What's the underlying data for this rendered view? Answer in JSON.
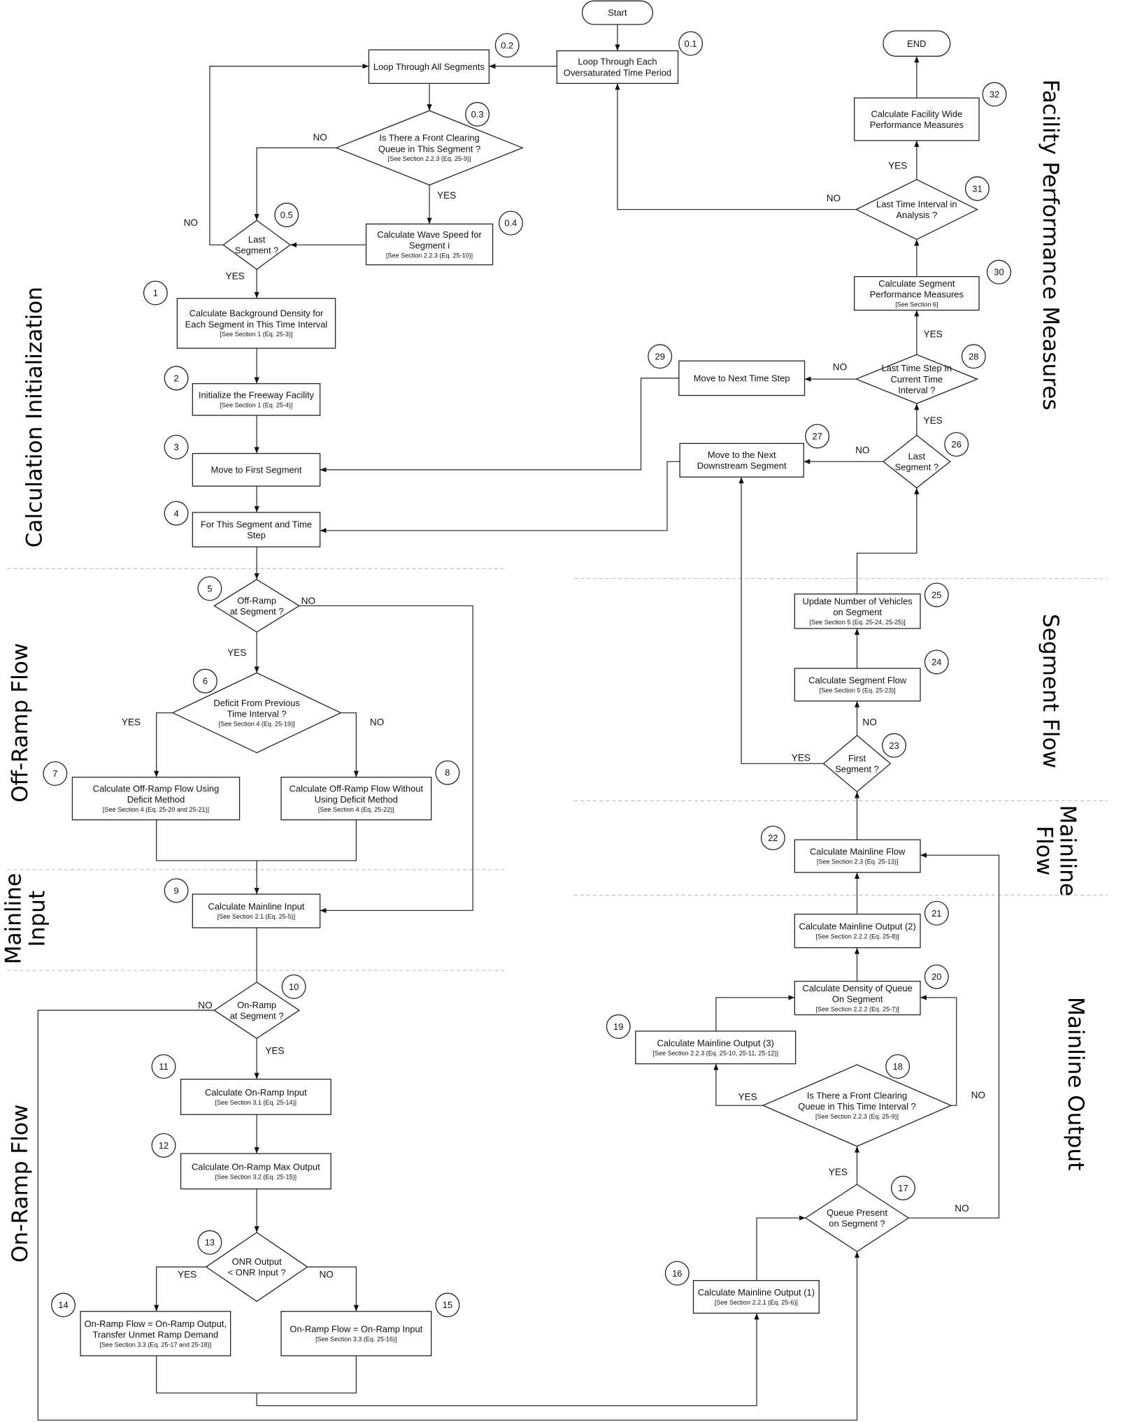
{
  "nodes": [
    {
      "id": "start",
      "step": "",
      "lines": [
        "Start"
      ],
      "ref": ""
    },
    {
      "id": "end",
      "step": "",
      "lines": [
        "END"
      ],
      "ref": ""
    },
    {
      "id": "0.1",
      "step": "0.1",
      "lines": [
        "Loop Through Each",
        "Oversaturated Time Period"
      ],
      "ref": ""
    },
    {
      "id": "0.2",
      "step": "0.2",
      "lines": [
        "Loop Through All Segments"
      ],
      "ref": ""
    },
    {
      "id": "0.3",
      "step": "0.3",
      "lines": [
        "Is There a Front Clearing",
        "Queue in This Segment ?"
      ],
      "ref": "[See Section 2.2.3 (Eq. 25-9)]"
    },
    {
      "id": "0.4",
      "step": "0.4",
      "lines": [
        "Calculate Wave Speed for",
        "Segment i"
      ],
      "ref": "[See Section 2.2.3 (Eq. 25-10)]"
    },
    {
      "id": "0.5",
      "step": "0.5",
      "lines": [
        "Last",
        "Segment ?"
      ],
      "ref": ""
    },
    {
      "id": "1",
      "step": "1",
      "lines": [
        "Calculate Background Density for",
        "Each Segment in This Time Interval"
      ],
      "ref": "[See Section 1 (Eq. 25-3)]"
    },
    {
      "id": "2",
      "step": "2",
      "lines": [
        "Initialize the Freeway Facility"
      ],
      "ref": "[See Section 1 (Eq. 25-4)]"
    },
    {
      "id": "3",
      "step": "3",
      "lines": [
        "Move to First Segment"
      ],
      "ref": ""
    },
    {
      "id": "4",
      "step": "4",
      "lines": [
        "For This Segment and Time",
        "Step"
      ],
      "ref": ""
    },
    {
      "id": "5",
      "step": "5",
      "lines": [
        "Off-Ramp",
        "at Segment ?"
      ],
      "ref": ""
    },
    {
      "id": "6",
      "step": "6",
      "lines": [
        "Deficit From Previous",
        "Time Interval ?"
      ],
      "ref": "[See Section 4 (Eq. 25-19)]"
    },
    {
      "id": "7",
      "step": "7",
      "lines": [
        "Calculate Off-Ramp Flow Using",
        "Deficit Method"
      ],
      "ref": "[See Section 4 (Eq. 25-20 and 25-21)]"
    },
    {
      "id": "8",
      "step": "8",
      "lines": [
        "Calculate Off-Ramp Flow Without",
        "Using Deficit Method"
      ],
      "ref": "[See Section 4 (Eq. 25-22)]"
    },
    {
      "id": "9",
      "step": "9",
      "lines": [
        "Calculate Mainline Input"
      ],
      "ref": "[See Section 2.1 (Eq. 25-5)]"
    },
    {
      "id": "10",
      "step": "10",
      "lines": [
        "On-Ramp",
        "at Segment ?"
      ],
      "ref": ""
    },
    {
      "id": "11",
      "step": "11",
      "lines": [
        "Calculate On-Ramp Input"
      ],
      "ref": "[See Section 3.1 (Eq. 25-14)]"
    },
    {
      "id": "12",
      "step": "12",
      "lines": [
        "Calculate On-Ramp Max Output"
      ],
      "ref": "[See Section 3.2 (Eq. 25-15)]"
    },
    {
      "id": "13",
      "step": "13",
      "lines": [
        "ONR Output",
        "< ONR Input ?"
      ],
      "ref": ""
    },
    {
      "id": "14",
      "step": "14",
      "lines": [
        "On-Ramp Flow = On-Ramp Output,",
        "Transfer Unmet Ramp Demand"
      ],
      "ref": "[See Section 3.3 (Eq. 25-17 and 25-18)]"
    },
    {
      "id": "15",
      "step": "15",
      "lines": [
        "On-Ramp Flow = On-Ramp Input"
      ],
      "ref": "[See Section 3.3 (Eq. 25-16)]"
    },
    {
      "id": "16",
      "step": "16",
      "lines": [
        "Calculate Mainline Output (1)"
      ],
      "ref": "[See Section 2.2.1 (Eq. 25-6)]"
    },
    {
      "id": "17",
      "step": "17",
      "lines": [
        "Queue Present",
        "on Segment ?"
      ],
      "ref": ""
    },
    {
      "id": "18",
      "step": "18",
      "lines": [
        "Is There a Front Clearing",
        "Queue in This Time Interval ?"
      ],
      "ref": "[See Section 2.2.3 (Eq. 25-9)]"
    },
    {
      "id": "19",
      "step": "19",
      "lines": [
        "Calculate Mainline Output (3)"
      ],
      "ref": "[See Section 2.2.3 (Eq. 25-10, 25-11, 25-12)]"
    },
    {
      "id": "20",
      "step": "20",
      "lines": [
        "Calculate Density of Queue",
        "On Segment"
      ],
      "ref": "[See Section 2.2.2 (Eq. 25-7)]"
    },
    {
      "id": "21",
      "step": "21",
      "lines": [
        "Calculate Mainline Output (2)"
      ],
      "ref": "[See Section 2.2.2 (Eq. 25-8)]"
    },
    {
      "id": "22",
      "step": "22",
      "lines": [
        "Calculate Mainline Flow"
      ],
      "ref": "[See Section 2.3 (Eq. 25-13)]"
    },
    {
      "id": "23",
      "step": "23",
      "lines": [
        "First",
        "Segment ?"
      ],
      "ref": ""
    },
    {
      "id": "24",
      "step": "24",
      "lines": [
        "Calculate Segment Flow"
      ],
      "ref": "[See Section 5 (Eq. 25-23)]"
    },
    {
      "id": "25",
      "step": "25",
      "lines": [
        "Update Number of Vehicles",
        "on Segment"
      ],
      "ref": "[See Section 5 (Eq. 25-24, 25-25)]"
    },
    {
      "id": "26",
      "step": "26",
      "lines": [
        "Last",
        "Segment ?"
      ],
      "ref": ""
    },
    {
      "id": "27",
      "step": "27",
      "lines": [
        "Move to the Next",
        "Downstream Segment"
      ],
      "ref": ""
    },
    {
      "id": "28",
      "step": "28",
      "lines": [
        "Last Time Step In",
        "Current Time",
        "Interval ?"
      ],
      "ref": ""
    },
    {
      "id": "29",
      "step": "29",
      "lines": [
        "Move to Next Time Step"
      ],
      "ref": ""
    },
    {
      "id": "30",
      "step": "30",
      "lines": [
        "Calculate Segment",
        "Performance Measures"
      ],
      "ref": "[See Section 6]"
    },
    {
      "id": "31",
      "step": "31",
      "lines": [
        "Last Time Interval in",
        "Analysis ?"
      ],
      "ref": ""
    },
    {
      "id": "32",
      "step": "32",
      "lines": [
        "Calculate Facility Wide",
        "Performance Measures"
      ],
      "ref": ""
    }
  ],
  "edges": [
    {
      "from": "start",
      "to": "0.1",
      "label": ""
    },
    {
      "from": "0.1",
      "to": "0.2",
      "label": ""
    },
    {
      "from": "0.2",
      "to": "0.3",
      "label": ""
    },
    {
      "from": "0.3",
      "to": "0.5",
      "label": "NO"
    },
    {
      "from": "0.3",
      "to": "0.4",
      "label": "YES"
    },
    {
      "from": "0.4",
      "to": "0.5",
      "label": ""
    },
    {
      "from": "0.5",
      "to": "0.2",
      "label": "NO"
    },
    {
      "from": "0.5",
      "to": "1",
      "label": "YES"
    },
    {
      "from": "1",
      "to": "2",
      "label": ""
    },
    {
      "from": "2",
      "to": "3",
      "label": ""
    },
    {
      "from": "3",
      "to": "4",
      "label": ""
    },
    {
      "from": "4",
      "to": "5",
      "label": ""
    },
    {
      "from": "5",
      "to": "9",
      "label": "NO"
    },
    {
      "from": "5",
      "to": "6",
      "label": "YES"
    },
    {
      "from": "6",
      "to": "7",
      "label": "YES"
    },
    {
      "from": "6",
      "to": "8",
      "label": "NO"
    },
    {
      "from": "7",
      "to": "9",
      "label": ""
    },
    {
      "from": "8",
      "to": "9",
      "label": ""
    },
    {
      "from": "9",
      "to": "10",
      "label": ""
    },
    {
      "from": "10",
      "to": "17",
      "label": "NO"
    },
    {
      "from": "10",
      "to": "11",
      "label": "YES"
    },
    {
      "from": "11",
      "to": "12",
      "label": ""
    },
    {
      "from": "12",
      "to": "13",
      "label": ""
    },
    {
      "from": "13",
      "to": "14",
      "label": "YES"
    },
    {
      "from": "13",
      "to": "15",
      "label": "NO"
    },
    {
      "from": "14",
      "to": "16",
      "label": ""
    },
    {
      "from": "15",
      "to": "16",
      "label": ""
    },
    {
      "from": "16",
      "to": "17",
      "label": ""
    },
    {
      "from": "17",
      "to": "22",
      "label": "NO"
    },
    {
      "from": "17",
      "to": "18",
      "label": "YES"
    },
    {
      "from": "18",
      "to": "19",
      "label": "YES"
    },
    {
      "from": "18",
      "to": "20",
      "label": "NO"
    },
    {
      "from": "19",
      "to": "20",
      "label": ""
    },
    {
      "from": "20",
      "to": "21",
      "label": ""
    },
    {
      "from": "21",
      "to": "22",
      "label": ""
    },
    {
      "from": "22",
      "to": "23",
      "label": ""
    },
    {
      "from": "23",
      "to": "24",
      "label": "NO"
    },
    {
      "from": "23",
      "to": "27",
      "label": "YES"
    },
    {
      "from": "24",
      "to": "25",
      "label": ""
    },
    {
      "from": "25",
      "to": "26",
      "label": ""
    },
    {
      "from": "26",
      "to": "27",
      "label": "NO"
    },
    {
      "from": "26",
      "to": "28",
      "label": "YES"
    },
    {
      "from": "27",
      "to": "4",
      "label": ""
    },
    {
      "from": "28",
      "to": "29",
      "label": "NO"
    },
    {
      "from": "28",
      "to": "30",
      "label": "YES"
    },
    {
      "from": "29",
      "to": "3",
      "label": ""
    },
    {
      "from": "30",
      "to": "31",
      "label": ""
    },
    {
      "from": "31",
      "to": "0.1",
      "label": "NO"
    },
    {
      "from": "31",
      "to": "32",
      "label": "YES"
    },
    {
      "from": "32",
      "to": "end",
      "label": ""
    }
  ],
  "sections": [
    {
      "id": "calc-init",
      "lines": [
        "Calculation Initialization"
      ]
    },
    {
      "id": "off-ramp",
      "lines": [
        "Off-Ramp Flow"
      ]
    },
    {
      "id": "mainline-input",
      "lines": [
        "Mainline",
        "Input"
      ]
    },
    {
      "id": "on-ramp",
      "lines": [
        "On-Ramp Flow"
      ]
    },
    {
      "id": "facility",
      "lines": [
        "Facility Performance Measures"
      ]
    },
    {
      "id": "segment-flow",
      "lines": [
        "Segment Flow"
      ]
    },
    {
      "id": "mainline-flow",
      "lines": [
        "Mainline",
        "Flow"
      ]
    },
    {
      "id": "mainline-output",
      "lines": [
        "Mainline Output"
      ]
    }
  ]
}
